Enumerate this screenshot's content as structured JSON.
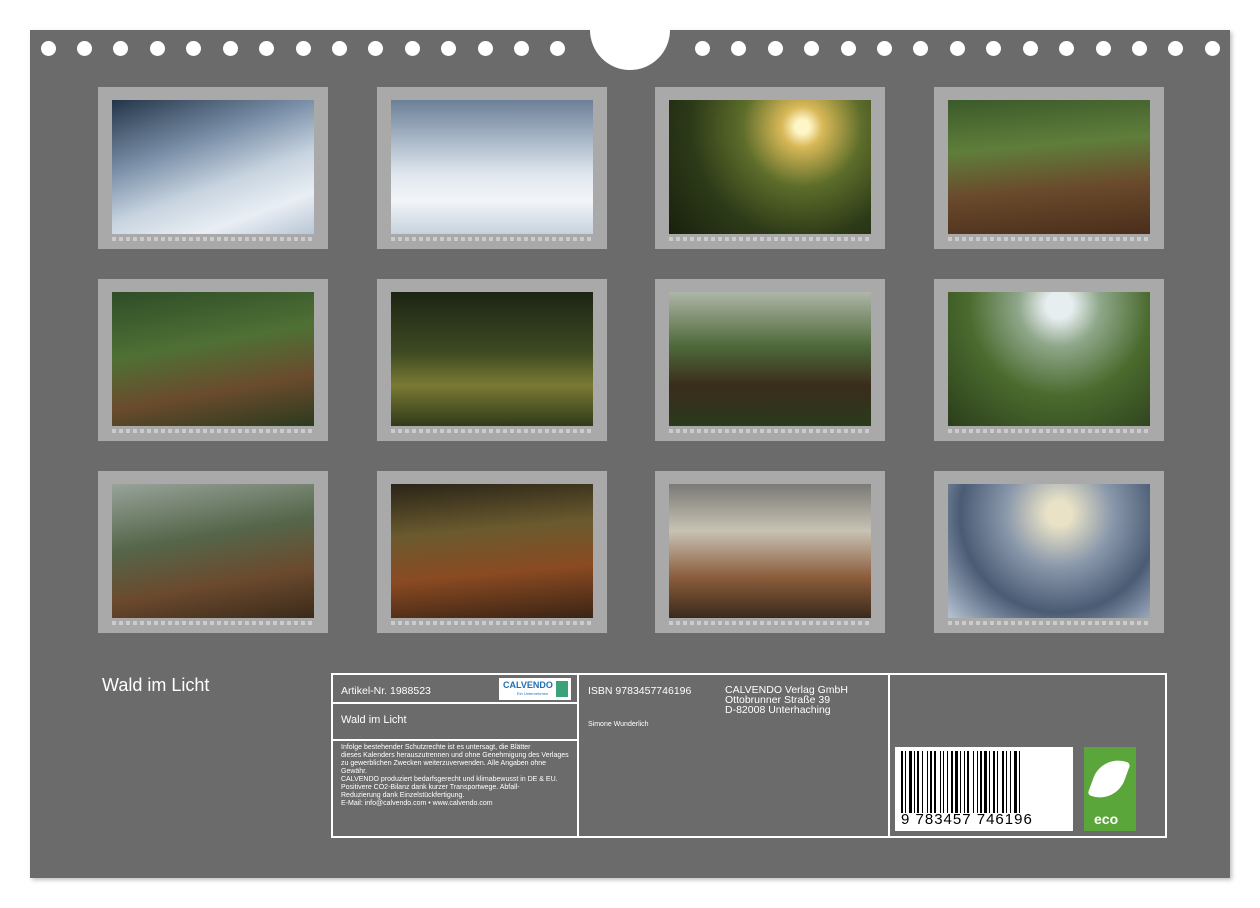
{
  "calendar": {
    "title": "Wald im Licht",
    "photos": [
      {
        "name": "snowy-forest-stream"
      },
      {
        "name": "snowy-forest-path"
      },
      {
        "name": "sunlit-forest"
      },
      {
        "name": "forest-ravine"
      },
      {
        "name": "green-forest-path"
      },
      {
        "name": "sunbeam-forest"
      },
      {
        "name": "old-tree-path"
      },
      {
        "name": "misty-green-path"
      },
      {
        "name": "misty-hillside-path"
      },
      {
        "name": "autumn-forest"
      },
      {
        "name": "foggy-autumn-forest"
      },
      {
        "name": "foggy-winter-field"
      }
    ]
  },
  "info": {
    "article": "Artikel-Nr. 1988523",
    "product_title": "Wald im Licht",
    "legal_lines": [
      "Infolge bestehender Schutzrechte ist es untersagt, die Blätter",
      "dieses Kalenders herauszutrennen und ohne Genehmigung des Verlages",
      "zu gewerblichen Zwecken weiterzuverwenden. Alle Angaben ohne",
      "Gewähr.",
      "CALVENDO produziert bedarfsgerecht und klimabewusst in DE & EU.",
      "Positivere CO2-Bilanz dank kurzer Transportwege. Abfall-",
      "Reduzierung dank Einzelstückfertigung.",
      "E-Mail: info@calvendo.com • www.calvendo.com"
    ],
    "isbn": "ISBN 9783457746196",
    "author": "Simone Wunderlich",
    "publisher": [
      "CALVENDO Verlag GmbH",
      "Ottobrunner Straße 39",
      "D-82008 Unterhaching"
    ],
    "logo_word": "CALVENDO",
    "logo_sub": "Ein Unternehmen",
    "barcode_number": "9  783457  746196",
    "eco_label": "eco"
  }
}
